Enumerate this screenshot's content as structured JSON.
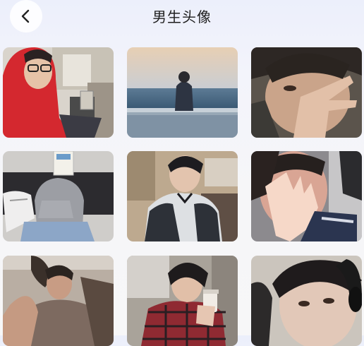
{
  "header": {
    "title": "男生头像"
  },
  "avatars": [
    {
      "name": "avatar-red-hoodie-glasses"
    },
    {
      "name": "avatar-seaside-back"
    },
    {
      "name": "avatar-peace-sign"
    },
    {
      "name": "avatar-book-face-grey-hoodie"
    },
    {
      "name": "avatar-black-white-jacket"
    },
    {
      "name": "avatar-hand-light-car"
    },
    {
      "name": "avatar-lying-grey-shirt"
    },
    {
      "name": "avatar-plaid-shirt-coffee"
    },
    {
      "name": "avatar-headphones-selfie"
    }
  ]
}
